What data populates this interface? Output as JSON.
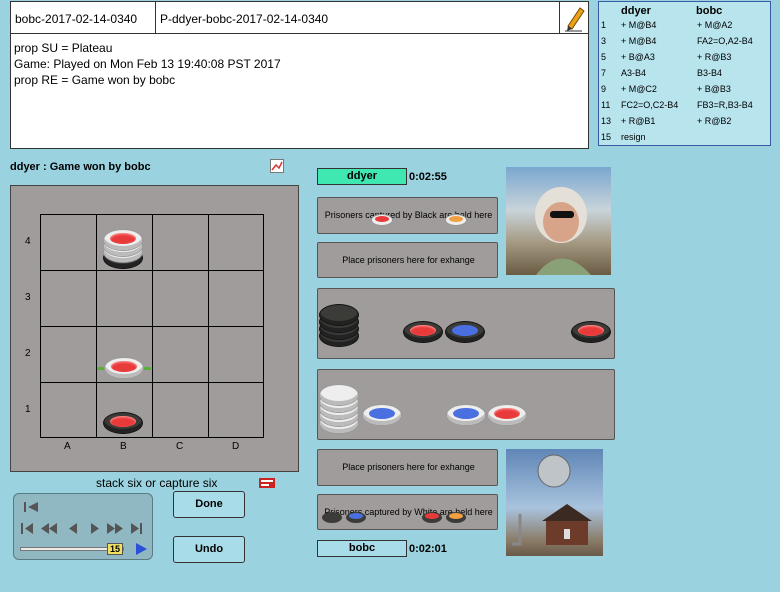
{
  "header": {
    "game_id": "bobc-2017-02-14-0340",
    "game_file": "P-ddyer-bobc-2017-02-14-0340"
  },
  "log": {
    "lines": [
      "prop SU = Plateau",
      "Game: Played on Mon Feb 13 19:40:08 PST 2017",
      "prop RE = Game won by bobc"
    ]
  },
  "moves": {
    "player1": "ddyer",
    "player2": "bobc",
    "rows": [
      {
        "n": "1",
        "a": "+ M@B4",
        "b": "+ M@A2"
      },
      {
        "n": "3",
        "a": "+ M@B4",
        "b": "FA2=O,A2-B4"
      },
      {
        "n": "5",
        "a": "+ B@A3",
        "b": "+ R@B3"
      },
      {
        "n": "7",
        "a": "A3-B4",
        "b": "B3-B4"
      },
      {
        "n": "9",
        "a": "+ M@C2",
        "b": "+ B@B3"
      },
      {
        "n": "11",
        "a": "FC2=O,C2-B4",
        "b": "FB3=R,B3-B4"
      },
      {
        "n": "13",
        "a": "+ R@B1",
        "b": "+ R@B2"
      },
      {
        "n": "15",
        "a": "resign",
        "b": ""
      }
    ]
  },
  "board": {
    "status": "ddyer : Game won by bobc",
    "rows": [
      "4",
      "3",
      "2",
      "1"
    ],
    "cols": [
      "A",
      "B",
      "C",
      "D"
    ],
    "caption": "stack six or capture six"
  },
  "players": {
    "top": {
      "name": "ddyer",
      "time": "0:02:55",
      "color": "#3ee8b0"
    },
    "bottom": {
      "name": "bobc",
      "time": "0:02:01",
      "color": "#a7dce8"
    }
  },
  "zones": {
    "black_prisoners": "Prisoners captured by  Black are held here",
    "exchange_top": "Place prisoners here for exhange",
    "exchange_bottom": "Place prisoners here for exhange",
    "white_prisoners": "Prisoners captured by  White are held here"
  },
  "controls": {
    "done_label": "Done",
    "undo_label": "Undo",
    "move_number": "15"
  }
}
